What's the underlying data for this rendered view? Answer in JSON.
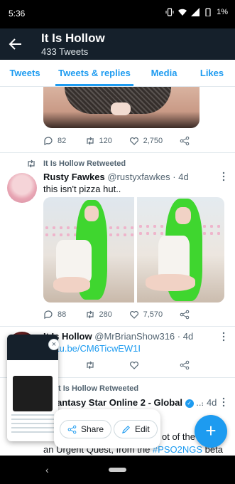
{
  "status_bar": {
    "time": "5:36",
    "battery": "1%"
  },
  "header": {
    "title": "It Is Hollow",
    "subtitle": "433 Tweets"
  },
  "tabs": [
    {
      "label": "Tweets"
    },
    {
      "label": "Tweets & replies",
      "active": true
    },
    {
      "label": "Media"
    },
    {
      "label": "Likes"
    }
  ],
  "tweet1": {
    "replies": "82",
    "retweets": "120",
    "likes": "2,750"
  },
  "tweet2": {
    "retweet_label": "It Is Hollow Retweeted",
    "name": "Rusty Fawkes",
    "handle": "@rustyxfawkes",
    "time": "· 4d",
    "text": "this isn't pizza hut..",
    "replies": "88",
    "retweets": "280",
    "likes": "7,570"
  },
  "tweet3": {
    "name": "It Is Hollow",
    "handle": "@MrBrianShow316",
    "time": "· 4d",
    "link": "tu.be/CM6TicwEW1I"
  },
  "tweet4": {
    "retweet_label": "t Is Hollow Retweeted",
    "name": "antasy Star Online 2 - Global",
    "ellipsis": "...",
    "time": "· 4d",
    "text_a": "ot of the",
    "text_b": "an Urgent Quest, from the",
    "hashtag": "#PSO2NGS",
    "text_c": "beta"
  },
  "share_overlay": {
    "share_label": "Share",
    "edit_label": "Edit"
  },
  "colors": {
    "accent": "#1d9bf0",
    "header_bg": "#15202b"
  }
}
